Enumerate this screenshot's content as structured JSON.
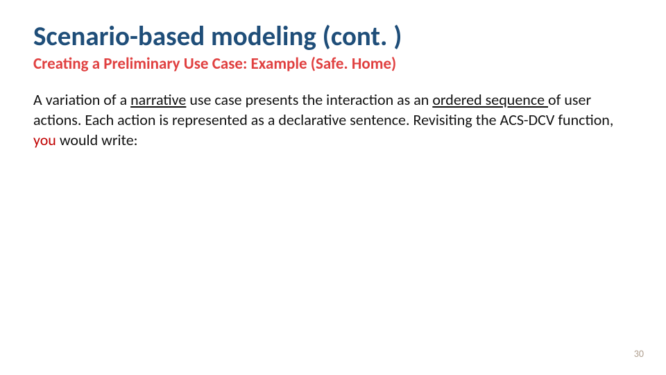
{
  "title": "Scenario-based modeling (cont. )",
  "subtitle": "Creating a Preliminary Use Case: Example (Safe. Home)",
  "body": {
    "t1": "A variation of a ",
    "narrative": "narrative",
    "t2": " use case presents the interaction as an ",
    "ordered": "ordered sequence ",
    "t3": "of user actions. Each action is represented as a declarative sentence. Revisiting the ACS-DCV function, ",
    "you": "you",
    "t4": " would write:"
  },
  "pageNumber": "30"
}
